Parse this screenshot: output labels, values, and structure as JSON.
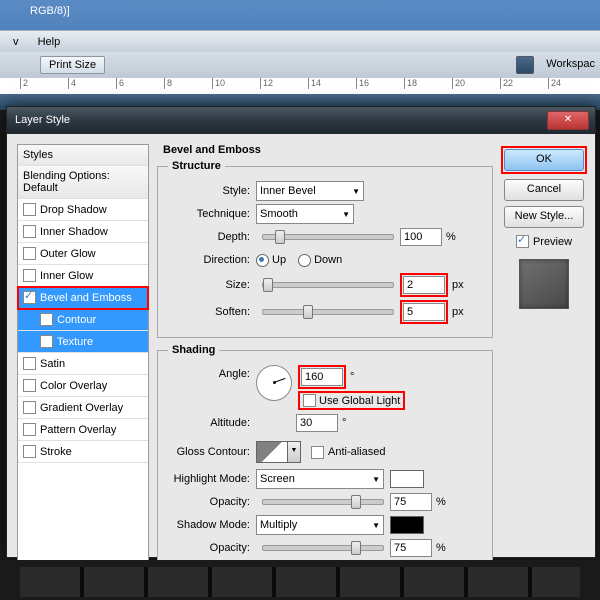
{
  "app": {
    "title_frag": "RGB/8)]"
  },
  "menu": {
    "view": "v",
    "help": "Help"
  },
  "toolbar": {
    "print_size": "Print Size",
    "workspace": "Workspac"
  },
  "ruler": {
    "ticks": [
      "2",
      "4",
      "6",
      "8",
      "10",
      "12",
      "14",
      "16",
      "18",
      "20",
      "22",
      "24"
    ]
  },
  "dialog": {
    "title": "Layer Style"
  },
  "sidebar": {
    "items": [
      {
        "label": "Styles",
        "header": true
      },
      {
        "label": "Blending Options: Default",
        "header": true
      },
      {
        "label": "Drop Shadow"
      },
      {
        "label": "Inner Shadow"
      },
      {
        "label": "Outer Glow"
      },
      {
        "label": "Inner Glow"
      },
      {
        "label": "Bevel and Emboss",
        "checked": true,
        "selected": true,
        "highlight": true
      },
      {
        "label": "Contour",
        "sub": true
      },
      {
        "label": "Texture",
        "sub": true
      },
      {
        "label": "Satin"
      },
      {
        "label": "Color Overlay"
      },
      {
        "label": "Gradient Overlay"
      },
      {
        "label": "Pattern Overlay"
      },
      {
        "label": "Stroke"
      }
    ]
  },
  "structure": {
    "legend": "Structure",
    "title": "Bevel and Emboss",
    "style_lbl": "Style:",
    "style": "Inner Bevel",
    "tech_lbl": "Technique:",
    "tech": "Smooth",
    "depth_lbl": "Depth:",
    "depth": "100",
    "depth_unit": "%",
    "dir_lbl": "Direction:",
    "up": "Up",
    "down": "Down",
    "size_lbl": "Size:",
    "size": "2",
    "size_unit": "px",
    "soft_lbl": "Soften:",
    "soft": "5",
    "soft_unit": "px"
  },
  "shading": {
    "legend": "Shading",
    "angle_lbl": "Angle:",
    "angle": "160",
    "deg": "°",
    "ugl": "Use Global Light",
    "alt_lbl": "Altitude:",
    "alt": "30",
    "gloss_lbl": "Gloss Contour:",
    "aa": "Anti-aliased",
    "hl_lbl": "Highlight Mode:",
    "hl": "Screen",
    "op_lbl": "Opacity:",
    "hl_op": "75",
    "sh_lbl": "Shadow Mode:",
    "sh": "Multiply",
    "sh_op": "75",
    "pct": "%"
  },
  "buttons": {
    "ok": "OK",
    "cancel": "Cancel",
    "new_style": "New Style...",
    "preview": "Preview"
  }
}
